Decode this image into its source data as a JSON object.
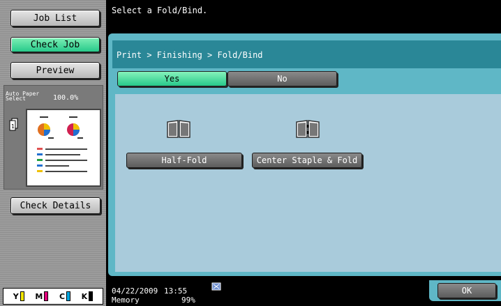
{
  "sidebar": {
    "job_list_label": "Job List",
    "check_job_label": "Check Job",
    "preview_label": "Preview",
    "auto_paper_label": "Auto Paper Select",
    "zoom_value": "100.0%",
    "check_details_label": "Check Details",
    "toner": [
      {
        "letter": "Y",
        "color": "#f2e600"
      },
      {
        "letter": "M",
        "color": "#e0007a"
      },
      {
        "letter": "C",
        "color": "#00a8e0"
      },
      {
        "letter": "K",
        "color": "#000000"
      }
    ]
  },
  "message": "Select a Fold/Bind.",
  "breadcrumb": "Print > Finishing > Fold/Bind",
  "toggle": {
    "yes_label": "Yes",
    "no_label": "No",
    "selected": "Yes"
  },
  "options": {
    "half_fold_label": "Half-Fold",
    "center_staple_label": "Center Staple & Fold"
  },
  "status": {
    "date": "04/22/2009",
    "time": "13:55",
    "memory_label": "Memory",
    "memory_value": "99%"
  },
  "ok_label": "OK",
  "colors": {
    "accent_green": "#27c98a",
    "panel_teal": "#5fb7c6",
    "content_blue": "#a9cbdb"
  }
}
